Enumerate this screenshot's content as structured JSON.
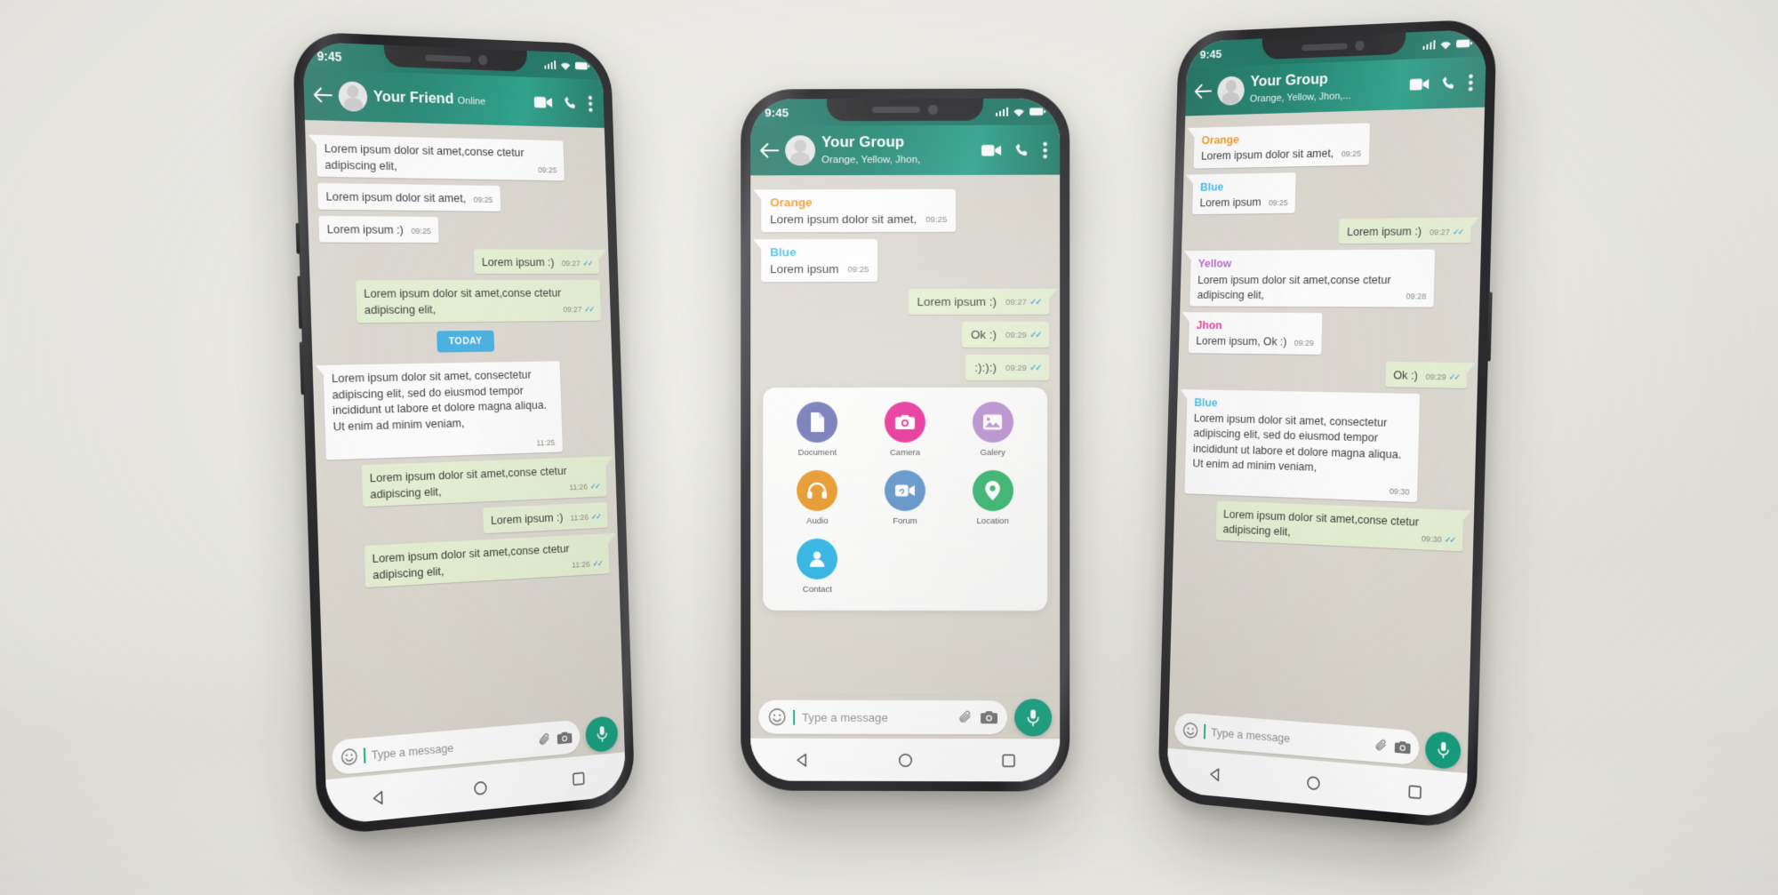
{
  "scene": {
    "background_color": "#ecebe5",
    "device_count": 3
  },
  "theme": {
    "header_green": "#11806a",
    "outgoing_bubble": "#e4f0cf",
    "incoming_bubble": "#ffffff",
    "chat_background": "#d9d5cc",
    "tick_blue": "#3ba3e0",
    "today_badge": "#2fa8e0",
    "mic_green": "#089a78"
  },
  "phone1": {
    "status": {
      "time": "9:45",
      "signal_icon": "signal-bars-icon",
      "wifi_icon": "wifi-icon",
      "battery_icon": "battery-icon"
    },
    "header": {
      "back_icon": "back-arrow-icon",
      "avatar": "contact-avatar",
      "title": "Your Friend",
      "subtitle": "Online",
      "video_icon": "video-call-icon",
      "call_icon": "phone-call-icon",
      "menu_icon": "more-vertical-icon"
    },
    "messages": [
      {
        "dir": "in",
        "text": "Lorem ipsum dolor sit amet,conse ctetur adipiscing elit,",
        "time": "09:25",
        "ticks": false
      },
      {
        "dir": "in",
        "text": "Lorem ipsum dolor sit amet,",
        "time": "09:25",
        "ticks": false
      },
      {
        "dir": "in",
        "text": "Lorem ipsum :)",
        "time": "09:25",
        "ticks": false
      },
      {
        "dir": "out",
        "text": "Lorem ipsum :)",
        "time": "09:27",
        "ticks": true
      },
      {
        "dir": "out",
        "text": "Lorem ipsum dolor sit amet,conse ctetur adipiscing elit,",
        "time": "09:27",
        "ticks": true
      }
    ],
    "divider": {
      "label": "TODAY"
    },
    "messages2": [
      {
        "dir": "in",
        "text": "Lorem ipsum dolor sit amet, consectetur adipiscing elit, sed do eiusmod tempor incididunt ut labore et dolore magna aliqua. Ut enim ad minim veniam,",
        "time": "11:25",
        "ticks": false
      },
      {
        "dir": "out",
        "text": "Lorem ipsum dolor sit amet,conse ctetur adipiscing elit,",
        "time": "11:26",
        "ticks": true
      },
      {
        "dir": "out",
        "text": "Lorem ipsum :)",
        "time": "11:26",
        "ticks": true
      },
      {
        "dir": "out",
        "text": "Lorem ipsum dolor sit amet,conse ctetur adipiscing elit,",
        "time": "11:26",
        "ticks": true
      }
    ],
    "input": {
      "emoji_icon": "emoji-smiley-icon",
      "placeholder": "Type a message",
      "value": "",
      "attach_icon": "paperclip-icon",
      "camera_icon": "camera-icon",
      "mic_icon": "microphone-icon"
    },
    "nav": {
      "back_icon": "nav-back-triangle-icon",
      "home_icon": "nav-home-circle-icon",
      "recents_icon": "nav-recents-square-icon"
    }
  },
  "phone2": {
    "status": {
      "time": "9:45",
      "signal_icon": "signal-bars-icon",
      "wifi_icon": "wifi-icon",
      "battery_icon": "battery-icon"
    },
    "header": {
      "back_icon": "back-arrow-icon",
      "avatar": "group-avatar",
      "title": "Your Group",
      "subtitle": "Orange, Yellow, Jhon,",
      "video_icon": "video-call-icon",
      "call_icon": "phone-call-icon",
      "menu_icon": "more-vertical-icon"
    },
    "messages": [
      {
        "dir": "in",
        "sender": "Orange",
        "sender_color": "#ef9114",
        "text": "Lorem ipsum dolor sit amet,",
        "time": "09:25",
        "ticks": false
      },
      {
        "dir": "in",
        "sender": "Blue",
        "sender_color": "#2eb7e8",
        "text": "Lorem ipsum",
        "time": "09:25",
        "ticks": false
      },
      {
        "dir": "out",
        "sender": "",
        "text": "Lorem ipsum :)",
        "time": "09:27",
        "ticks": true
      },
      {
        "dir": "out",
        "sender": "",
        "text": "Ok :)",
        "time": "09:29",
        "ticks": true
      },
      {
        "dir": "out",
        "sender": "",
        "text": ":):):)",
        "time": "09:29",
        "ticks": true
      }
    ],
    "attachments": [
      {
        "label": "Document",
        "icon": "document-icon",
        "color": "#5c63ab"
      },
      {
        "label": "Camera",
        "icon": "camera-icon",
        "color": "#e5128a"
      },
      {
        "label": "Galery",
        "icon": "gallery-image-icon",
        "color": "#b07fca"
      },
      {
        "label": "Audio",
        "icon": "headphones-icon",
        "color": "#e58a0b"
      },
      {
        "label": "Forum",
        "icon": "video-link-icon",
        "color": "#4a86c2"
      },
      {
        "label": "Location",
        "icon": "location-pin-icon",
        "color": "#1bab5a"
      },
      {
        "label": "Contact",
        "icon": "person-icon",
        "color": "#16ace3"
      }
    ],
    "input": {
      "emoji_icon": "emoji-smiley-icon",
      "placeholder": "Type a message",
      "value": "",
      "attach_icon": "paperclip-icon",
      "camera_icon": "camera-icon",
      "mic_icon": "microphone-icon"
    },
    "nav": {
      "back_icon": "nav-back-triangle-icon",
      "home_icon": "nav-home-circle-icon",
      "recents_icon": "nav-recents-square-icon"
    }
  },
  "phone3": {
    "status": {
      "time": "9:45",
      "signal_icon": "signal-bars-icon",
      "wifi_icon": "wifi-icon",
      "battery_icon": "battery-icon"
    },
    "header": {
      "back_icon": "back-arrow-icon",
      "avatar": "group-avatar",
      "title": "Your Group",
      "subtitle": "Orange, Yellow, Jhon,...",
      "video_icon": "video-call-icon",
      "call_icon": "phone-call-icon",
      "menu_icon": "more-vertical-icon"
    },
    "messages": [
      {
        "dir": "in",
        "sender": "Orange",
        "sender_color": "#ef9114",
        "text": "Lorem ipsum dolor sit amet,",
        "time": "09:25",
        "ticks": false
      },
      {
        "dir": "in",
        "sender": "Blue",
        "sender_color": "#2eb7e8",
        "text": "Lorem ipsum",
        "time": "09:25",
        "ticks": false
      },
      {
        "dir": "out",
        "sender": "",
        "text": "Lorem ipsum :)",
        "time": "09:27",
        "ticks": true
      },
      {
        "dir": "in",
        "sender": "Yellow",
        "sender_color": "#b158c4",
        "text": "Lorem ipsum dolor sit amet,conse ctetur adipiscing elit,",
        "time": "09:28",
        "ticks": false
      },
      {
        "dir": "in",
        "sender": "Jhon",
        "sender_color": "#ec1f8c",
        "text": "Lorem ipsum, Ok :)",
        "time": "09:29",
        "ticks": false
      },
      {
        "dir": "out",
        "sender": "",
        "text": "Ok :)",
        "time": "09:29",
        "ticks": true
      },
      {
        "dir": "in",
        "sender": "Blue",
        "sender_color": "#2eb7e8",
        "text": "Lorem ipsum dolor sit amet, consectetur adipiscing elit, sed do eiusmod tempor incididunt ut labore et dolore magna aliqua. Ut enim ad minim veniam,",
        "time": "09:30",
        "ticks": false
      },
      {
        "dir": "out",
        "sender": "",
        "text": "Lorem ipsum dolor sit amet,conse ctetur adipiscing elit,",
        "time": "09:30",
        "ticks": true
      }
    ],
    "input": {
      "emoji_icon": "emoji-smiley-icon",
      "placeholder": "Type a message",
      "value": "",
      "attach_icon": "paperclip-icon",
      "camera_icon": "camera-icon",
      "mic_icon": "microphone-icon"
    },
    "nav": {
      "back_icon": "nav-back-triangle-icon",
      "home_icon": "nav-home-circle-icon",
      "recents_icon": "nav-recents-square-icon"
    }
  }
}
